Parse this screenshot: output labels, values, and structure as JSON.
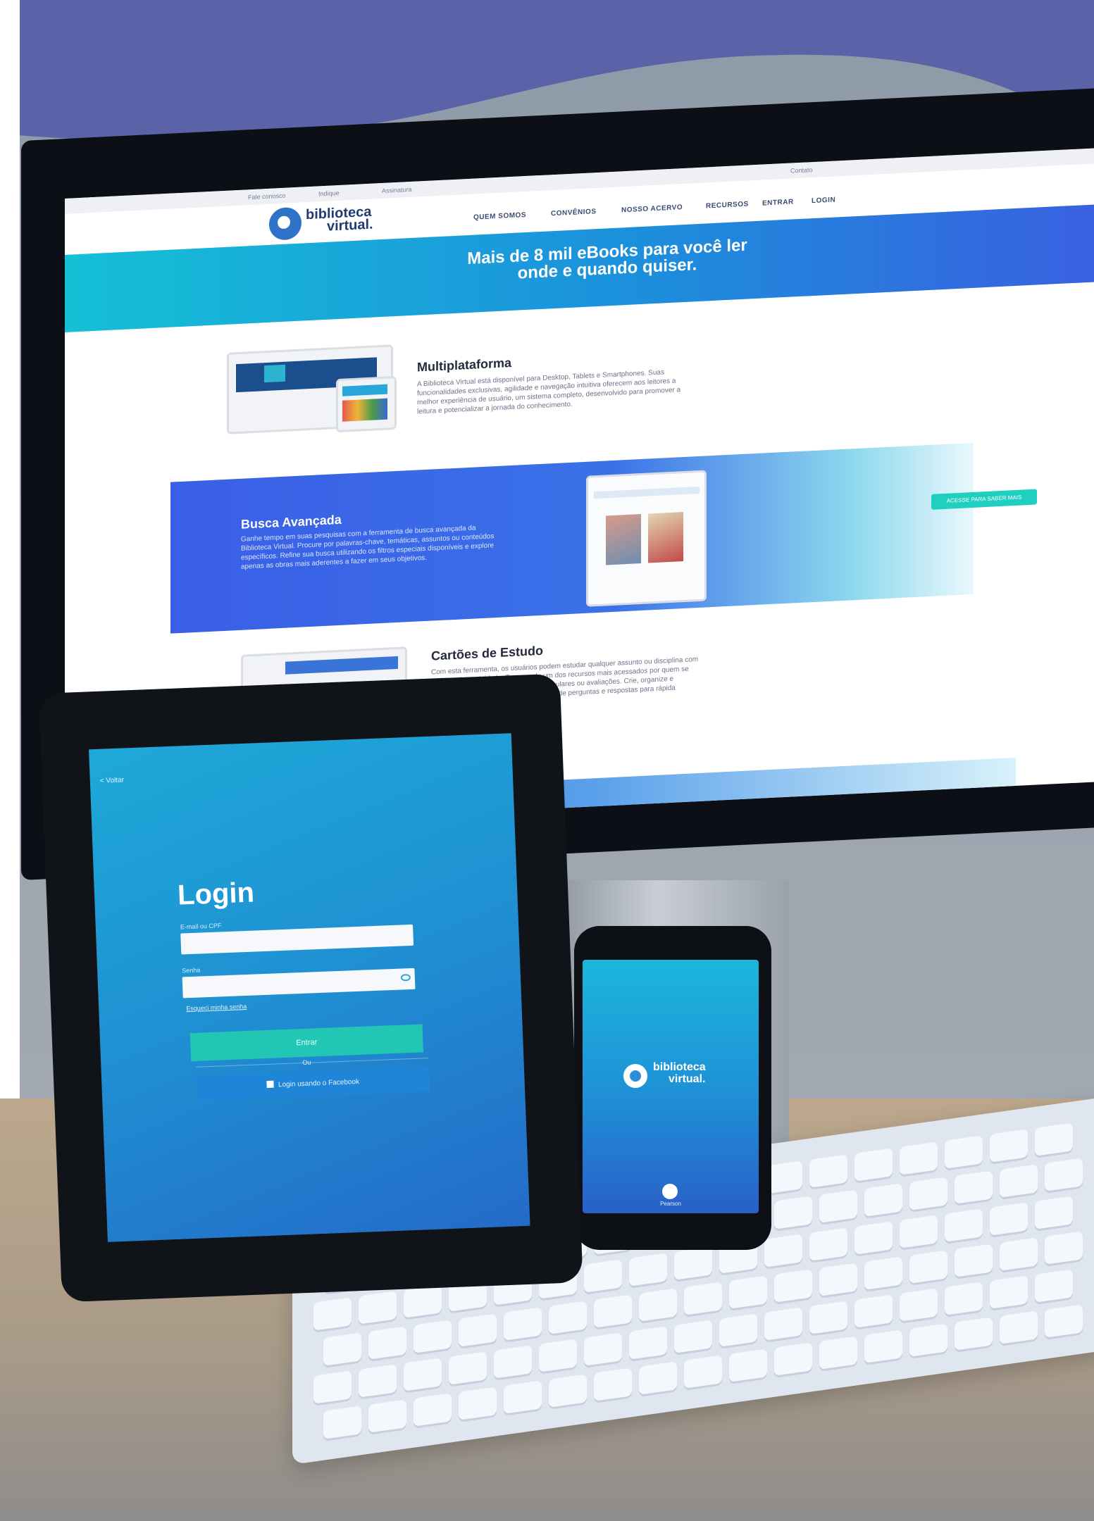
{
  "website": {
    "topbar": {
      "links": [
        "Fale conosco",
        "Indique",
        "Assinatura"
      ],
      "right": "Contato"
    },
    "logo": {
      "line1": "biblioteca",
      "line2": "virtual."
    },
    "nav": [
      "QUEM SOMOS",
      "CONVÊNIOS",
      "NOSSO ACERVO",
      "RECURSOS",
      "ENTRAR",
      "LOGIN"
    ],
    "hero": {
      "line1": "Mais de 8 mil eBooks para você ler",
      "line2": "onde e quando quiser."
    },
    "multiplataforma": {
      "title": "Multiplataforma",
      "text": "A Biblioteca Virtual está disponível para Desktop, Tablets e Smartphones. Suas funcionalidades exclusivas, agilidade e navegação intuitiva oferecem aos leitores a melhor experiência de usuário, um sistema completo, desenvolvido para promover a leitura e potencializar a jornada do conhecimento."
    },
    "busca": {
      "title": "Busca Avançada",
      "text": "Ganhe tempo em suas pesquisas com a ferramenta de busca avançada da Biblioteca Virtual. Procure por palavras-chave, temáticas, assuntos ou conteúdos específicos. Refine sua busca utilizando os filtros especiais disponíveis e explore apenas as obras mais aderentes a fazer em seus objetivos.",
      "cta": "ACESSE PARA SABER MAIS"
    },
    "cartoes": {
      "title": "Cartões de Estudo",
      "text": "Com esta ferramenta, os usuários podem estudar qualquer assunto ou disciplina com muito mais praticidade. Trata-se de um dos recursos mais acessados por quem se prepara para concursos públicos, vestibulares ou avaliações. Crie, organize e relacione os conceitos mais importantes de perguntas e respostas para rápida assimilação do conteúdo."
    }
  },
  "tablet": {
    "back": "< Voltar",
    "title": "Login",
    "email_label": "E-mail ou CPF",
    "password_label": "Senha",
    "forgot": "Esqueci minha senha",
    "submit": "Entrar",
    "divider": "Ou",
    "facebook": "Login usando o Facebook"
  },
  "phone": {
    "logo_line1": "biblioteca",
    "logo_line2": "virtual.",
    "bottom_label": "Pearson"
  },
  "colors": {
    "purple_wave": "#5a62a8",
    "hero_start": "#15c0d6",
    "hero_end": "#3a5fe0",
    "cta": "#1fd0c0",
    "brand_blue": "#2f73c8"
  }
}
